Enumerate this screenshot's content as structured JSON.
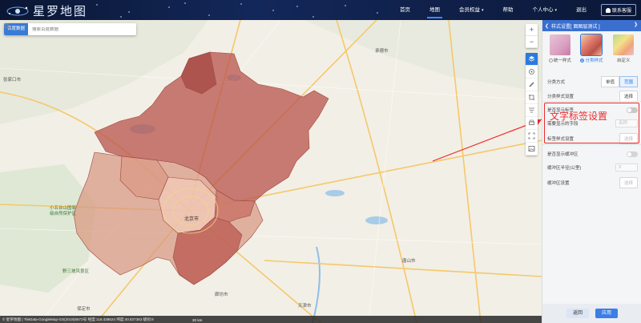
{
  "app": {
    "brand": "星罗地图"
  },
  "nav": {
    "items": [
      "首页",
      "地图",
      "会员权益",
      "帮助",
      "个人中心",
      "退出"
    ],
    "active_index": 1,
    "contact": "联系客服"
  },
  "search": {
    "source": "百度数据",
    "placeholder": "搜索百度数据"
  },
  "map": {
    "places": {
      "zhangjiakou": "张家口市",
      "chengde": "承德市",
      "beijing": "北京市",
      "langfang": "廊坊市",
      "tianjin": "天津市",
      "tangshan": "唐山市",
      "baoding": "保定市",
      "park1": "小五台山国家\n级自然保护区",
      "park2": "野三坡风景区"
    }
  },
  "panel": {
    "title": "样式设置[ 面图层测试 ]",
    "styles": [
      {
        "label": "统一样式",
        "selected": false
      },
      {
        "label": "分类样式",
        "selected": true
      },
      {
        "label": "自定义",
        "selected": false
      }
    ],
    "classify_method_label": "分类方式",
    "classify_options": [
      "单值",
      "范围"
    ],
    "classify_active": "范围",
    "classify_style_label": "分类样式设置",
    "select_btn": "选择",
    "show_label_label": "是否显示标签",
    "label_field_label": "需要显示的字段",
    "label_field_value": "名称",
    "label_style_label": "标签样式设置",
    "label_style_btn": "选择",
    "cluster_label": "是否显示缓冲区",
    "radius_label": "缓冲区半径(公里)",
    "radius_value": "2",
    "buffer_style_label": "缓冲区设置",
    "buffer_style_btn": "选择",
    "back_btn": "返回",
    "apply_btn": "应用"
  },
  "annotation": {
    "text": "文字标签设置",
    "color": "#ee2a2a"
  },
  "statusbar": {
    "text": "© 星罗地图 | TileData-GoogleMap-GS(2018)5572号  经度:118.438624  纬度:40.827363  级别:9",
    "scale": "20 km"
  },
  "colors": {
    "accent": "#2b7ae0",
    "region_dark": "#b8534a",
    "region_light": "#d9957f"
  }
}
